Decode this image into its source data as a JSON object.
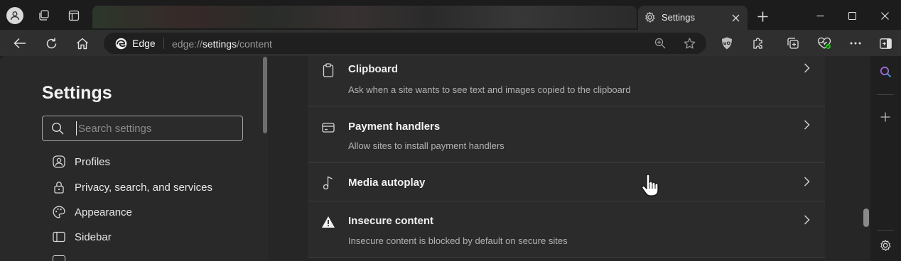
{
  "tab": {
    "active_title": "Settings",
    "close_icon": "close-icon",
    "new_tab_icon": "plus-icon"
  },
  "window": {
    "minimize_icon": "minimize-icon",
    "maximize_icon": "maximize-icon",
    "close_icon": "close-icon"
  },
  "toolbar": {
    "browser_label": "Edge",
    "url_prefix": "edge://",
    "url_highlight": "settings",
    "url_suffix": "/content"
  },
  "sidebar": {
    "title": "Settings",
    "search_placeholder": "Search settings",
    "items": [
      {
        "label": "Profiles",
        "icon": "profile-icon"
      },
      {
        "label": "Privacy, search, and services",
        "icon": "lock-icon"
      },
      {
        "label": "Appearance",
        "icon": "palette-icon"
      },
      {
        "label": "Sidebar",
        "icon": "sidebar-icon"
      }
    ]
  },
  "content": {
    "items": [
      {
        "title": "Clipboard",
        "description": "Ask when a site wants to see text and images copied to the clipboard",
        "icon": "clipboard-icon"
      },
      {
        "title": "Payment handlers",
        "description": "Allow sites to install payment handlers",
        "icon": "card-icon"
      },
      {
        "title": "Media autoplay",
        "description": "",
        "icon": "music-note-icon"
      },
      {
        "title": "Insecure content",
        "description": "Insecure content is blocked by default on secure sites",
        "icon": "warning-icon"
      }
    ]
  },
  "colors": {
    "background": "#1f1f1f",
    "panel": "#292929",
    "card": "#2b2b2b",
    "text": "#e8e8e8",
    "muted": "#b3b3b3",
    "accent_purple": "#9b6cd6",
    "extension_green": "#16c60c"
  }
}
